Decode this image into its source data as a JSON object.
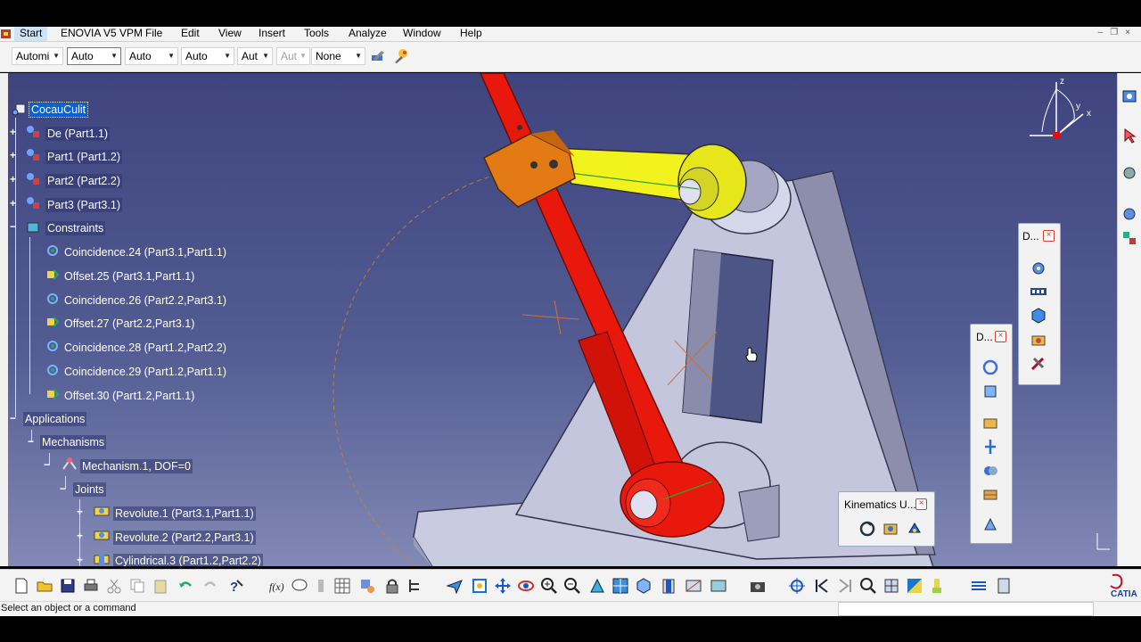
{
  "menu": {
    "items": [
      "Start",
      "ENOVIA V5 VPM",
      "File",
      "Edit",
      "View",
      "Insert",
      "Tools",
      "Analyze",
      "Window",
      "Help"
    ]
  },
  "dimbar": {
    "combos": [
      {
        "value": "Automi",
        "state": "normal"
      },
      {
        "value": "Auto",
        "state": "selected"
      },
      {
        "value": "Auto",
        "state": "normal"
      },
      {
        "value": "Auto",
        "state": "normal"
      },
      {
        "value": "Aut",
        "state": "normal"
      },
      {
        "value": "Aut",
        "state": "disabled"
      },
      {
        "value": "None",
        "state": "normal"
      }
    ]
  },
  "tree": {
    "root": "CocauCulit",
    "parts": [
      "De (Part1.1)",
      "Part1 (Part1.2)",
      "Part2 (Part2.2)",
      "Part3 (Part3.1)"
    ],
    "constraints_label": "Constraints",
    "constraints": [
      "Coincidence.24 (Part3.1,Part1.1)",
      "Offset.25 (Part3.1,Part1.1)",
      "Coincidence.26 (Part2.2,Part3.1)",
      "Offset.27 (Part2.2,Part3.1)",
      "Coincidence.28 (Part1.2,Part2.2)",
      "Coincidence.29 (Part1.2,Part1.1)",
      "Offset.30 (Part1.2,Part1.1)"
    ],
    "applications": "Applications",
    "mechanisms": "Mechanisms",
    "mechanism": "Mechanism.1, DOF=0",
    "joints_label": "Joints",
    "joints": [
      "Revolute.1 (Part3.1,Part1.1)",
      "Revolute.2 (Part2.2,Part3.1)",
      "Cylindrical.3 (Part1.2,Part2.2)"
    ]
  },
  "toolbars": {
    "d1_title": "D...",
    "d2_title": "D...",
    "kinematics_title": "Kinematics U...",
    "close_glyph": "×"
  },
  "compass": {
    "x_label": "x",
    "y_label": "y",
    "z_label": "z"
  },
  "status": {
    "text": "Select an object or a command"
  },
  "brand": {
    "logo_text": "CATIA"
  },
  "colors": {
    "viewport_top": "#3f447e",
    "viewport_bottom": "#8289b5",
    "tree_selection": "#0b61d0",
    "rod_red": "#e8180d",
    "link_yellow": "#f2f21c",
    "block_orange": "#e37a14",
    "base_gray": "#c6c8dd"
  }
}
